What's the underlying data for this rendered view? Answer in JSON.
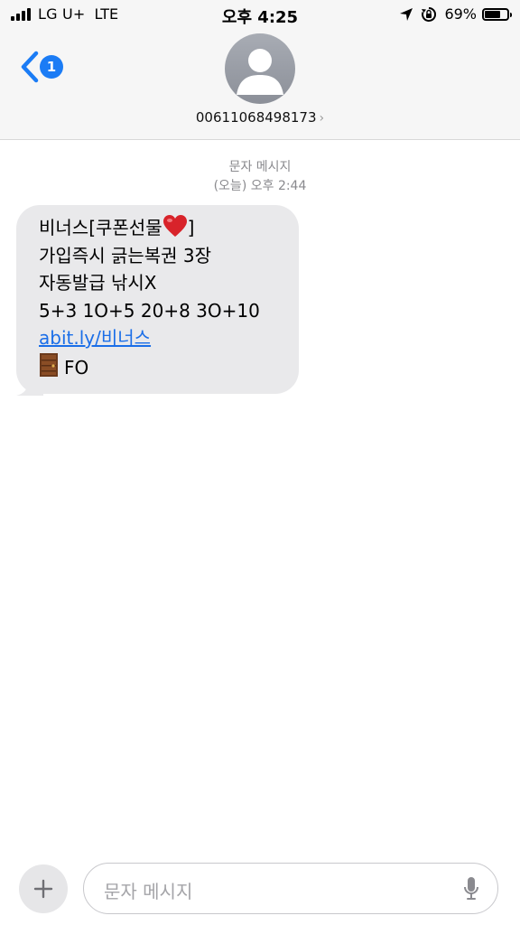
{
  "status_bar": {
    "carrier": "LG U+",
    "network": "LTE",
    "time": "오후 4:25",
    "battery_percent": "69%",
    "battery_level": 0.69
  },
  "nav": {
    "back_badge": "1",
    "contact_number": "00611068498173"
  },
  "conversation": {
    "type_label": "문자 메시지",
    "timestamp": "(오늘) 오후 2:44"
  },
  "message": {
    "line1": "비너스[쿠폰선물",
    "line1_end": "]",
    "line2": "가입즉시 긁는복권 3장",
    "line3": "자동발급 낚시X",
    "line4": "5+3 1O+5 20+8 3O+10",
    "link": "abit.ly/비너스",
    "line6": "FO"
  },
  "composer": {
    "placeholder": "문자 메시지"
  },
  "colors": {
    "accent": "#1b7cf5",
    "bubble": "#e9e9eb",
    "link": "#1a6ee8"
  },
  "icons": [
    "signal-icon",
    "location-arrow-icon",
    "rotation-lock-icon",
    "battery-icon",
    "chevron-left-icon",
    "person-icon",
    "heart-emoji-icon",
    "door-emoji-icon",
    "plus-icon",
    "microphone-icon"
  ]
}
